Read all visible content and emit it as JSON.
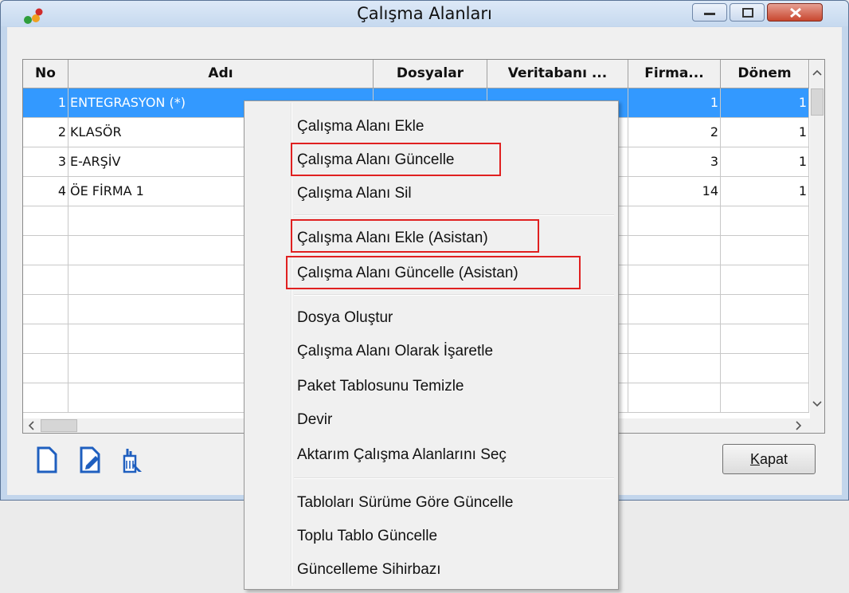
{
  "window": {
    "title": "Çalışma Alanları"
  },
  "table": {
    "headers": [
      "No",
      "Adı",
      "Dosyalar",
      "Veritabanı ...",
      "Firma...",
      "Dönem"
    ],
    "rows": [
      {
        "no": "1",
        "name": "ENTEGRASYON (*)",
        "firma": "1",
        "donem": "1",
        "selected": true
      },
      {
        "no": "2",
        "name": "KLASÖR",
        "firma": "2",
        "donem": "1"
      },
      {
        "no": "3",
        "name": "E-ARŞİV",
        "firma": "3",
        "donem": "1"
      },
      {
        "no": "4",
        "name": "ÖE FİRMA 1",
        "firma": "14",
        "donem": "1"
      }
    ]
  },
  "buttons": {
    "kapat_first": "K",
    "kapat_rest": "apat"
  },
  "toolbar_icons": [
    "new-document-icon",
    "edit-document-icon",
    "clean-table-icon"
  ],
  "context_menu": {
    "items": [
      "Çalışma Alanı Ekle",
      "Çalışma Alanı Güncelle",
      "Çalışma Alanı Sil",
      "Çalışma Alanı Ekle (Asistan)",
      "Çalışma Alanı Güncelle (Asistan)",
      "Dosya Oluştur",
      "Çalışma Alanı Olarak İşaretle",
      "Paket Tablosunu Temizle",
      "Devir",
      "Aktarım Çalışma Alanlarını Seç",
      "Tabloları Sürüme Göre Güncelle",
      "Toplu Tablo Güncelle",
      "Güncelleme Sihirbazı"
    ],
    "highlighted": [
      "Çalışma Alanı Güncelle",
      "Çalışma Alanı Ekle (Asistan)",
      "Çalışma Alanı Güncelle (Asistan)"
    ]
  },
  "colors": {
    "selection": "#3399ff",
    "highlight_box": "#e02020"
  }
}
